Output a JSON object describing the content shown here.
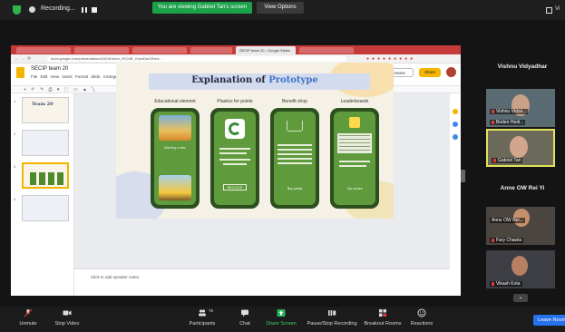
{
  "zoom_top": {
    "recording_label": "Recording...",
    "banner": "You are viewing Gabriel Tan's screen",
    "view_options": "View Options",
    "view_toggle": "Vi"
  },
  "browser": {
    "active_tab": "SECIP team 20 - Google Slides",
    "url": "docs.google.com/presentation/d/1D3rUkeh_0G2dE_rXpwDwCRxtw..."
  },
  "slides_app": {
    "doc_title": "SECIP team 20",
    "menus": [
      "File",
      "Edit",
      "View",
      "Insert",
      "Format",
      "Slide",
      "Arrange",
      "Tools",
      "Add-ons",
      "Help"
    ],
    "menu_line": "File  Edit  View  Insert  Format  Slide  Arrange  Tools  Add-ons  Help",
    "toolbar_words": "Background   Layout   Theme   Transition",
    "present_label": "Present",
    "share_label": "Share",
    "speaker_notes_placeholder": "Click to add speaker notes",
    "thumb_title": "Team 20",
    "thumb_numbers": [
      "1",
      "2",
      "3",
      "4"
    ]
  },
  "slide": {
    "title_main": "Explanation of ",
    "title_accent": "Prototype",
    "columns": [
      {
        "label": "Educational element",
        "text": "Watching a video"
      },
      {
        "label": "Plastics for points",
        "button": "RECYCLE"
      },
      {
        "label": "Benefit shop",
        "button": "Buy points"
      },
      {
        "label": "Leaderboards",
        "button": "Top scores"
      }
    ]
  },
  "participants": {
    "header_1": "Vishnu Vidyadhar",
    "tiles_1": [
      {
        "name": "Vishnu Vidya..."
      },
      {
        "name": "Boden Hedi..."
      },
      {
        "name": "Gabriel Tan"
      }
    ],
    "header_2": "Anne OW Rei Yi",
    "tiles_2": [
      {
        "name": "Anne OW Rei..."
      },
      {
        "name": "Fary Chawla"
      },
      {
        "name": "Vikash Kota"
      }
    ]
  },
  "bottom_bar": {
    "unmute": "Unmute",
    "stop_video": "Stop Video",
    "participants": "Participants",
    "participants_count": "76",
    "chat": "Chat",
    "share_screen": "Share Screen",
    "pause_recording": "Pause/Stop Recording",
    "breakout_rooms": "Breakout Rooms",
    "reactions": "Reactions",
    "leave": "Leave Room"
  },
  "colors": {
    "zoom_green": "#1ca24b",
    "slides_yellow": "#f4b400",
    "phone_green": "#5f9a3c",
    "leave_blue": "#2672ec"
  }
}
